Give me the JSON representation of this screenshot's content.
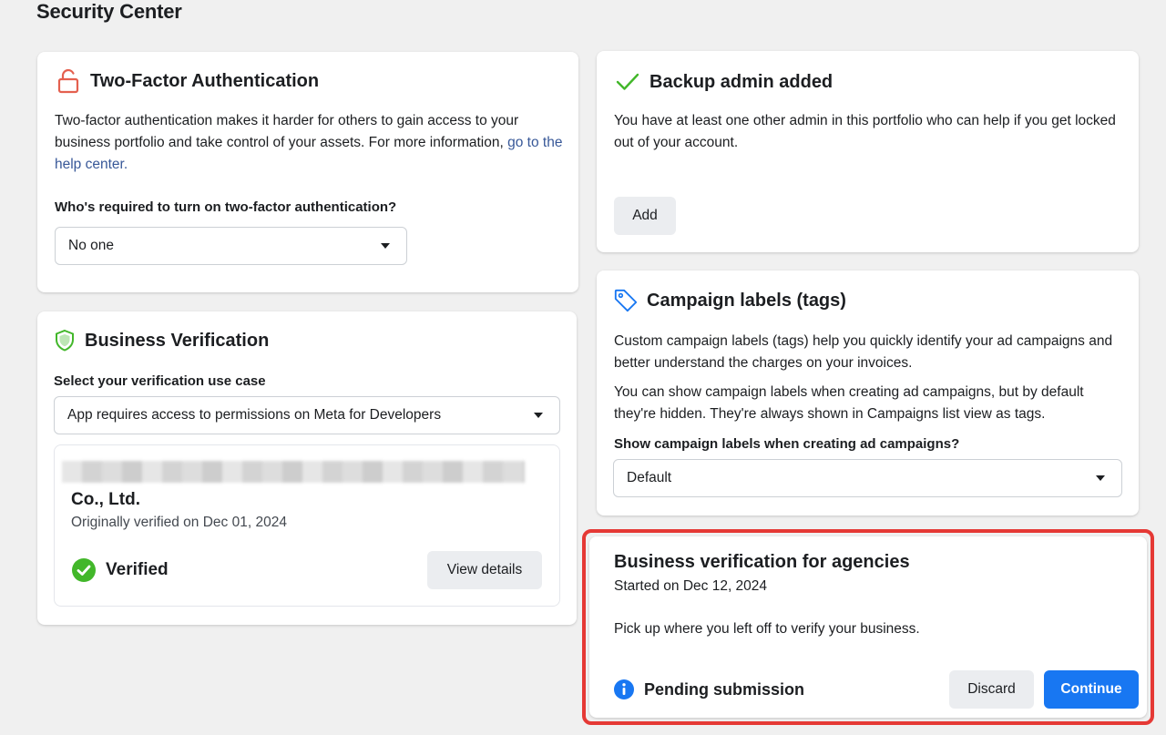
{
  "page": {
    "title": "Security Center"
  },
  "two_factor": {
    "title": "Two-Factor Authentication",
    "description": "Two-factor authentication makes it harder for others to gain access to your business portfolio and take control of your assets. For more information, ",
    "link_text": "go to the help center.",
    "question": "Who's required to turn on two-factor authentication?",
    "selected": "No one",
    "icon": "unlock-icon",
    "icon_color": "#e4604f"
  },
  "backup_admin": {
    "title": "Backup admin added",
    "description": "You have at least one other admin in this portfolio who can help if you get locked out of your account.",
    "add_label": "Add",
    "icon": "checkmark-icon",
    "icon_color": "#42b72a"
  },
  "business_verification": {
    "title": "Business Verification",
    "use_case_label": "Select your verification use case",
    "use_case_selected": "App requires access to permissions on Meta for Developers",
    "company_name": "Co., Ltd.",
    "verified_date": "Originally verified on Dec 01, 2024",
    "status": "Verified",
    "view_details_label": "View details",
    "icon": "shield-icon",
    "icon_color": "#42b72a"
  },
  "campaign_labels": {
    "title": "Campaign labels (tags)",
    "description1": "Custom campaign labels (tags) help you quickly identify your ad campaigns and better understand the charges on your invoices.",
    "description2": "You can show campaign labels when creating ad campaigns, but by default they're hidden. They're always shown in Campaigns list view as tags.",
    "question": "Show campaign labels when creating ad campaigns?",
    "selected": "Default",
    "icon": "tag-icon",
    "icon_color": "#1877f2"
  },
  "agency_verification": {
    "title": "Business verification for agencies",
    "started": "Started on Dec 12, 2024",
    "description": "Pick up where you left off to verify your business.",
    "status": "Pending submission",
    "discard_label": "Discard",
    "continue_label": "Continue",
    "icon": "info-icon",
    "icon_color": "#1877f2",
    "highlight_color": "#e53935"
  }
}
